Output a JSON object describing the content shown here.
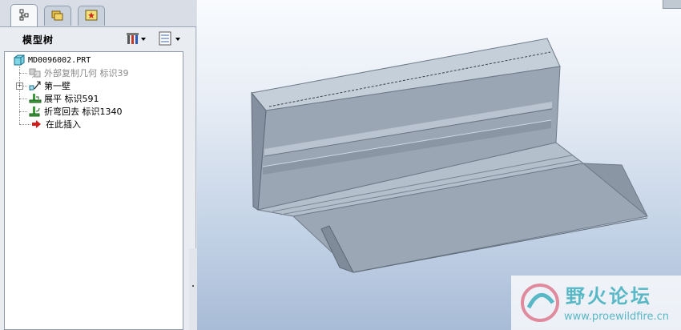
{
  "tabs": [
    {
      "icon": "model-tree-icon",
      "active": true
    },
    {
      "icon": "folder-browser-icon",
      "active": false
    },
    {
      "icon": "favorites-icon",
      "active": false
    }
  ],
  "tree_header": {
    "title": "模型树",
    "settings_icon": "tree-settings-icon",
    "show_icon": "tree-columns-icon"
  },
  "tree": {
    "root": "MD0096002.PRT",
    "items": [
      {
        "label": "外部复制几何  标识39",
        "icon": "copy-geometry-icon",
        "state": "suppressed"
      },
      {
        "label": "第一壁",
        "icon": "first-wall-icon",
        "state": "normal"
      },
      {
        "label": "展平  标识591",
        "icon": "unbend-icon",
        "state": "normal"
      },
      {
        "label": "折弯回去  标识1340",
        "icon": "bend-back-icon",
        "state": "normal"
      },
      {
        "label": "在此插入",
        "icon": "insert-here-arrow-icon",
        "state": "normal"
      }
    ]
  },
  "watermark": {
    "title": "野火论坛",
    "url": "www.proewildfire.cn"
  }
}
